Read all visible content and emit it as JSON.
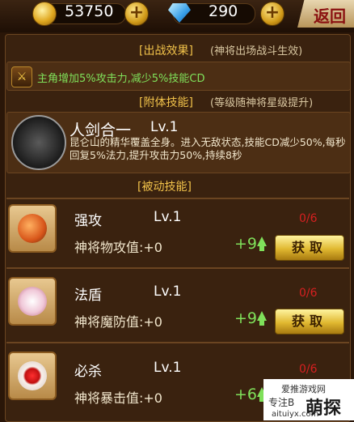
{
  "topbar": {
    "coin_icon": "gold-coin-icon",
    "coin_value": "53750",
    "gem_icon": "diamond-icon",
    "gem_value": "290",
    "plus_label": "+",
    "back_label": "返回"
  },
  "battle_effect": {
    "title": "[出战效果]",
    "subtitle": "(神将出场战斗生效)",
    "icon": "sword-icon",
    "text": "主角增加5%攻击力,减少5%技能CD"
  },
  "attach_skill": {
    "title": "[附体技能]",
    "subtitle": "(等级随神将星级提升)",
    "name": "人剑合一",
    "level": "Lv.1",
    "description": "昆仑山的精华覆盖全身。进入无敌状态,技能CD减少50%,每秒回复5%法力,提升攻击力50%,持续8秒"
  },
  "passive_header": "[被动技能]",
  "passives": [
    {
      "name": "强攻",
      "level": "Lv.1",
      "count": "0/6",
      "stat": "神将物攻值:+0",
      "bonus": "+9",
      "button": "获取",
      "icon": "orb-staff-icon"
    },
    {
      "name": "法盾",
      "level": "Lv.1",
      "count": "0/6",
      "stat": "神将魔防值:+0",
      "bonus": "+9",
      "button": "获取",
      "icon": "lotus-icon"
    },
    {
      "name": "必杀",
      "level": "Lv.1",
      "count": "0/6",
      "stat": "神将暴击值:+0",
      "bonus": "+6",
      "button": "获取",
      "icon": "red-pearl-icon"
    }
  ],
  "watermark": {
    "line1": "爱推游戏网",
    "line2": "专注B",
    "line3": "萌探",
    "line4": "aituiyx.com"
  },
  "colors": {
    "accent_gold": "#f1c24a",
    "green": "#7fe05a",
    "red_count": "#d62020",
    "panel": "#3a220f"
  }
}
